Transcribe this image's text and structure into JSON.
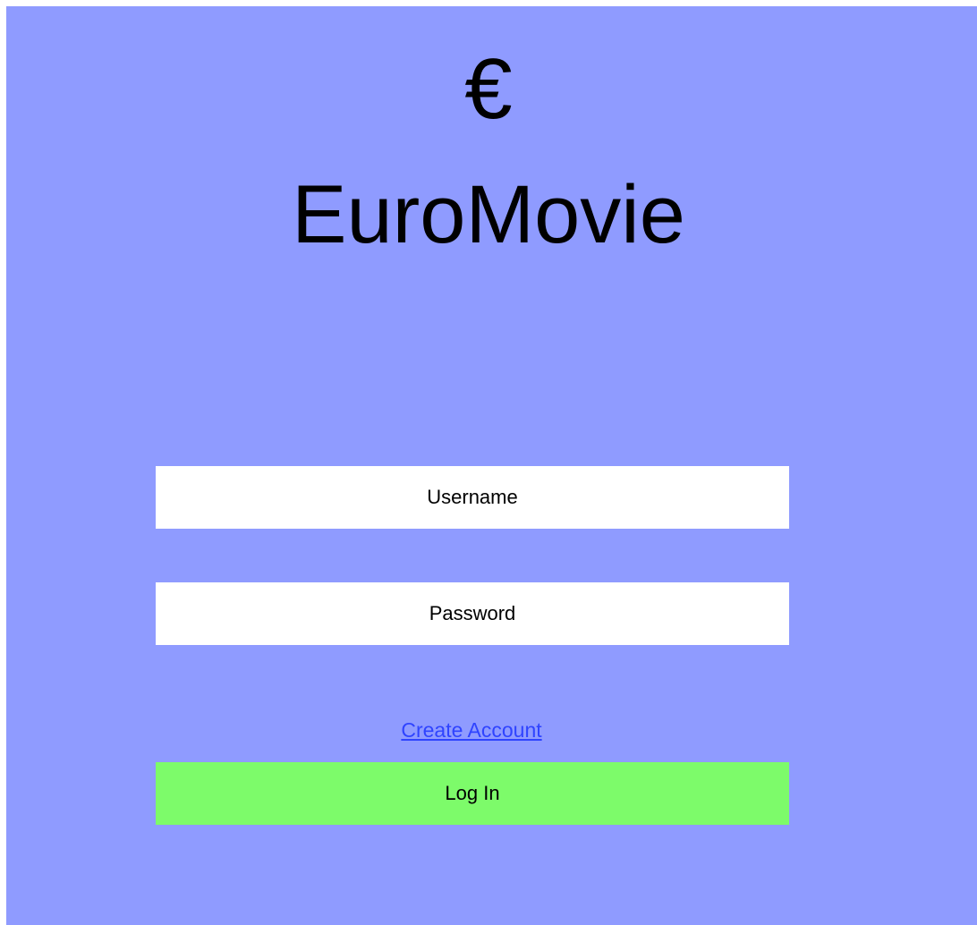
{
  "app": {
    "logo_symbol": "€",
    "title": "EuroMovie"
  },
  "form": {
    "username_placeholder": "Username",
    "username_value": "",
    "password_placeholder": "Password",
    "password_value": "",
    "create_account_label": "Create Account",
    "login_label": "Log In"
  },
  "colors": {
    "background": "#8f9bff",
    "field_background": "#ffffff",
    "link": "#2f44ff",
    "login_button": "#7dfb6a"
  },
  "icons": {
    "logo": "euro-sign-icon"
  }
}
